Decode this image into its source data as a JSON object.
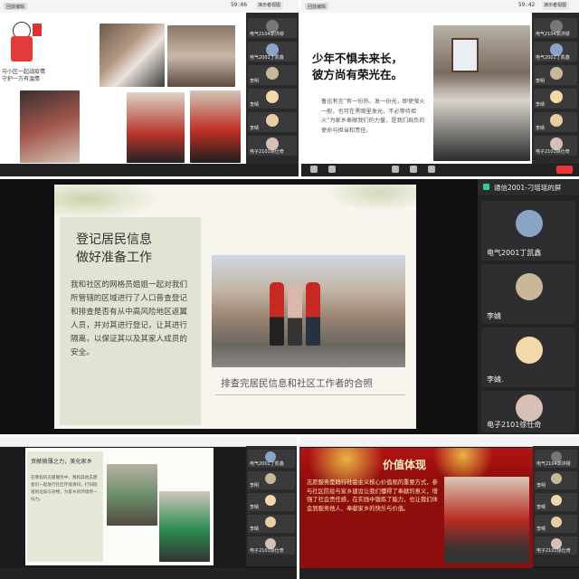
{
  "p1": {
    "topbar_chip": "回放编辑",
    "time": "59:06",
    "rec_label": "演示者视图",
    "sketch_text": "与小区一起战疫情\n守护一方有温情",
    "sidebar": [
      "电气2104郭洪缪",
      "电气2001丁凯鑫",
      "李明",
      "李晴",
      "李晴",
      "电子2101徐仕奇"
    ]
  },
  "p2": {
    "topbar_chip": "回放编辑",
    "time": "59:42",
    "rec_label": "演示者视图",
    "title_line1": "少年不惧未来长，",
    "title_line2": "彼方尚有荣光在。",
    "body": "鲁迅有言“有一份热，发一份光，即使萤火一般，也可在黑暗里发光，不必等待炬火”为家乡奉献我们的力量，是我们肩负的使命与担当和责任。",
    "sidebar": [
      "电气2104郭洪缪",
      "电气2001丁凯鑫",
      "李明",
      "李晴",
      "李晴",
      "电子2101徐仕奇"
    ]
  },
  "p3": {
    "slide_title1": "登记居民信息",
    "slide_title2": "做好准备工作",
    "slide_body": "我和社区的网格员姐姐一起对我们所管辖的区域进行了人口普查登记和排查是否有从中高风险地区返翼人员，并对其进行登记，让其进行隔离，以保证其以及其家人成员的安全。",
    "caption": "排查完居民信息和社区工作者的合照",
    "sidebar_header": "通信2001-刁瑶瑶的屏",
    "tiles": [
      {
        "name": "电气2001丁凯鑫",
        "avatar_color": "#8aa4c8"
      },
      {
        "name": "李婧",
        "avatar_color": "#c9b79a"
      },
      {
        "name": "李婧.",
        "avatar_color": "#f3d9a8"
      },
      {
        "name": "电子2101徐仕奇",
        "avatar_color": "#d9c0b6"
      }
    ]
  },
  "p4": {
    "slide_title": "贡献微薄之力，美化家乡",
    "slide_body": "在寒假的志愿服务中，我和其他志愿者们一起进行社区环境清扫，打扫街道的垃圾与杂物，为家乡的环境尽一份力。",
    "sidebar": [
      "电气2001丁凯鑫",
      "李明",
      "李晴",
      "李晴",
      "电子2101徐仕奇"
    ]
  },
  "p5": {
    "title": "价值体现",
    "body": "志愿服务是践行社会主义核心价值观的重要方式，参与社区防疫与家乡建设让我们懂得了奉献的意义，增强了社会责任感，在实践中锻炼了能力，也让我们体会到服务他人、奉献家乡的快乐与价值。",
    "sidebar": [
      "电气2104郭洪缪",
      "李明",
      "李晴",
      "李晴",
      "电子2101徐仕奇"
    ]
  }
}
